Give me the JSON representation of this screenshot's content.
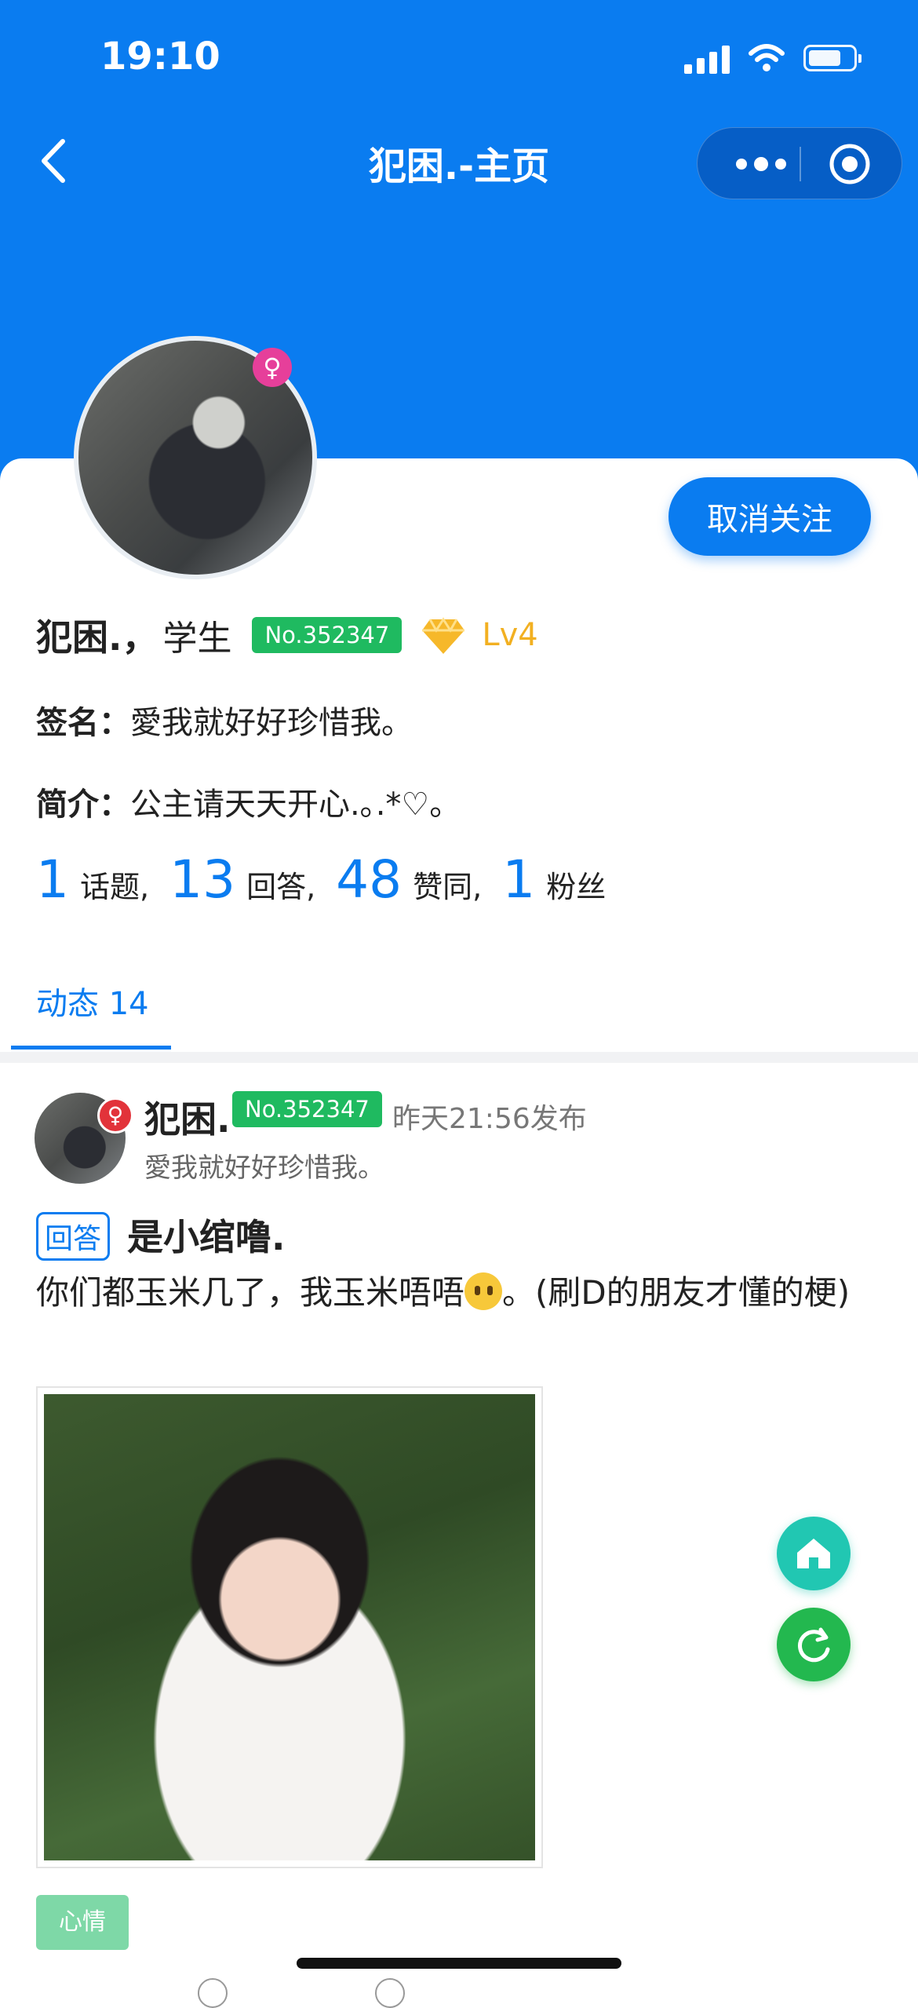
{
  "status_bar": {
    "time": "19:10"
  },
  "nav": {
    "title": "犯困.-主页"
  },
  "profile": {
    "follow_button": "取消关注",
    "nickname": "犯困.",
    "separator": "，",
    "occupation": "学生",
    "member_no": "No.352347",
    "level": "Lv4",
    "signature_key": "签名：",
    "signature": "愛我就好好珍惜我。",
    "intro_key": "简介：",
    "intro": "公主请天天开心.｡.*♡。",
    "stats": [
      {
        "num": "1",
        "label": "话题,"
      },
      {
        "num": "13",
        "label": "回答,"
      },
      {
        "num": "48",
        "label": "赞同,"
      },
      {
        "num": "1",
        "label": "粉丝"
      }
    ]
  },
  "tabs": {
    "active": "动态 14"
  },
  "post": {
    "author": "犯困.",
    "member_no": "No.352347",
    "time": "昨天21:56发布",
    "signature": "愛我就好好珍惜我。",
    "type_tag": "回答",
    "title": "是小绾噜.",
    "body_before": "你们都玉米几了，我玉米唔唔",
    "body_after": "。(刷D的朋友才懂的梗)",
    "tag": "心情"
  },
  "colors": {
    "primary": "#0a7cf0",
    "badge_green": "#1fba60",
    "level_gold": "#f2b021",
    "fab_home": "#21c7b2",
    "fab_refresh": "#23b84f"
  },
  "icons": [
    "back-chevron-icon",
    "more-dots-icon",
    "target-icon",
    "female-icon",
    "diamond-icon",
    "home-icon",
    "refresh-icon"
  ]
}
